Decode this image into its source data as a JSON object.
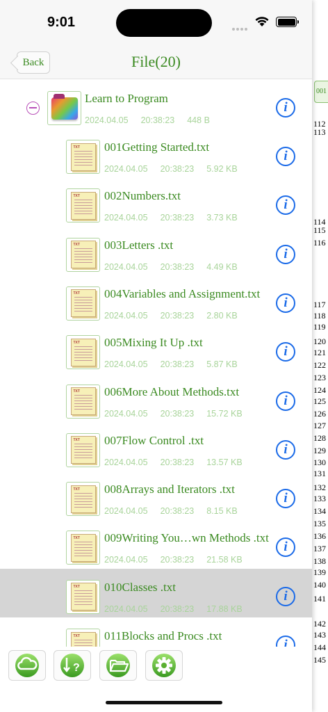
{
  "status": {
    "time": "9:01"
  },
  "nav": {
    "back_label": "Back",
    "title": "File(20)"
  },
  "folder": {
    "name": "Learn to Program",
    "date": "2024.04.05",
    "time": "20:38:23",
    "size": "448 B"
  },
  "files": [
    {
      "name": "001Getting Started.txt",
      "date": "2024.04.05",
      "time": "20:38:23",
      "size": "5.92 KB"
    },
    {
      "name": "002Numbers.txt",
      "date": "2024.04.05",
      "time": "20:38:23",
      "size": "3.73 KB"
    },
    {
      "name": "003Letters .txt",
      "date": "2024.04.05",
      "time": "20:38:23",
      "size": "4.49 KB"
    },
    {
      "name": "004Variables and Assignment.txt",
      "date": "2024.04.05",
      "time": "20:38:23",
      "size": "2.80 KB"
    },
    {
      "name": "005Mixing It Up .txt",
      "date": "2024.04.05",
      "time": "20:38:23",
      "size": "5.87 KB"
    },
    {
      "name": "006More About Methods.txt",
      "date": "2024.04.05",
      "time": "20:38:23",
      "size": "15.72 KB"
    },
    {
      "name": "007Flow Control .txt",
      "date": "2024.04.05",
      "time": "20:38:23",
      "size": "13.57 KB"
    },
    {
      "name": "008Arrays and Iterators .txt",
      "date": "2024.04.05",
      "time": "20:38:23",
      "size": "8.15 KB"
    },
    {
      "name": "009Writing You…wn Methods .txt",
      "date": "2024.04.05",
      "time": "20:38:23",
      "size": "21.58 KB"
    },
    {
      "name": "010Classes .txt",
      "date": "2024.04.05",
      "time": "20:38:23",
      "size": "17.88 KB"
    },
    {
      "name": "011Blocks and Procs .txt",
      "date": "",
      "time": "",
      "size": ""
    }
  ],
  "selected_index": 9,
  "info_glyph": "i",
  "toolbar": [
    {
      "icon": "cloud-icon"
    },
    {
      "icon": "help-sort-icon"
    },
    {
      "icon": "folder-open-icon"
    },
    {
      "icon": "gear-icon"
    }
  ],
  "background": {
    "tab_label": "001",
    "line_numbers": [
      "112",
      "113",
      "114",
      "115",
      "116",
      "117",
      "118",
      "119",
      "120",
      "121",
      "122",
      "123",
      "124",
      "125",
      "126",
      "127",
      "128",
      "129",
      "130",
      "131",
      "132",
      "133",
      "134",
      "135",
      "136",
      "137",
      "138",
      "139",
      "140",
      "141",
      "142",
      "143",
      "144",
      "145"
    ]
  },
  "colors": {
    "accent_green": "#3a8a20",
    "meta_green": "#a8d49a",
    "info_blue": "#1a6ae8",
    "selected_row": "#d5d5d5"
  }
}
